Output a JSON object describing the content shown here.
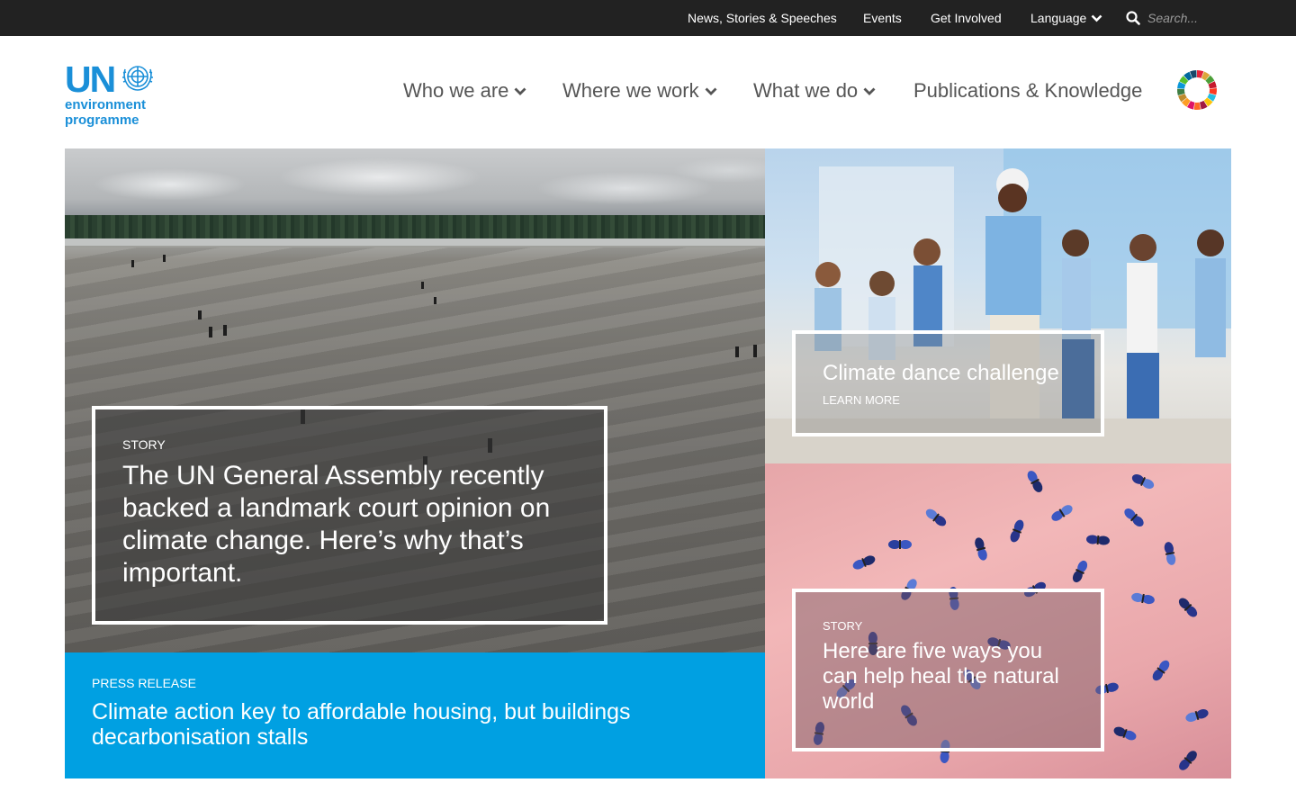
{
  "topbar": {
    "links": [
      "News, Stories & Speeches",
      "Events",
      "Get Involved"
    ],
    "language_label": "Language",
    "search_placeholder": "Search..."
  },
  "logo": {
    "mark": "UN",
    "line1": "environment",
    "line2": "programme"
  },
  "nav": {
    "items": [
      {
        "label": "Who we are",
        "has_dropdown": true
      },
      {
        "label": "Where we work",
        "has_dropdown": true
      },
      {
        "label": "What we do",
        "has_dropdown": true
      },
      {
        "label": "Publications & Knowledge",
        "has_dropdown": false
      }
    ],
    "sdg_wheel_icon": "sdg-wheel-icon"
  },
  "hero": {
    "kicker": "STORY",
    "headline": "The UN General Assembly recently backed a landmark court opinion on climate change. Here’s why that’s important."
  },
  "press_release": {
    "kicker": "PRESS RELEASE",
    "headline": "Climate action key to affordable housing, but buildings decarbonisation stalls"
  },
  "tiles": [
    {
      "title": "Climate dance challenge",
      "cta": "LEARN MORE"
    },
    {
      "kicker": "STORY",
      "title": "Here are five ways you can help heal the natural world"
    }
  ],
  "colors": {
    "topbar_bg": "#222222",
    "brand_blue": "#1a8fd8",
    "press_bg": "#00a0e2",
    "nav_text": "#555555"
  }
}
